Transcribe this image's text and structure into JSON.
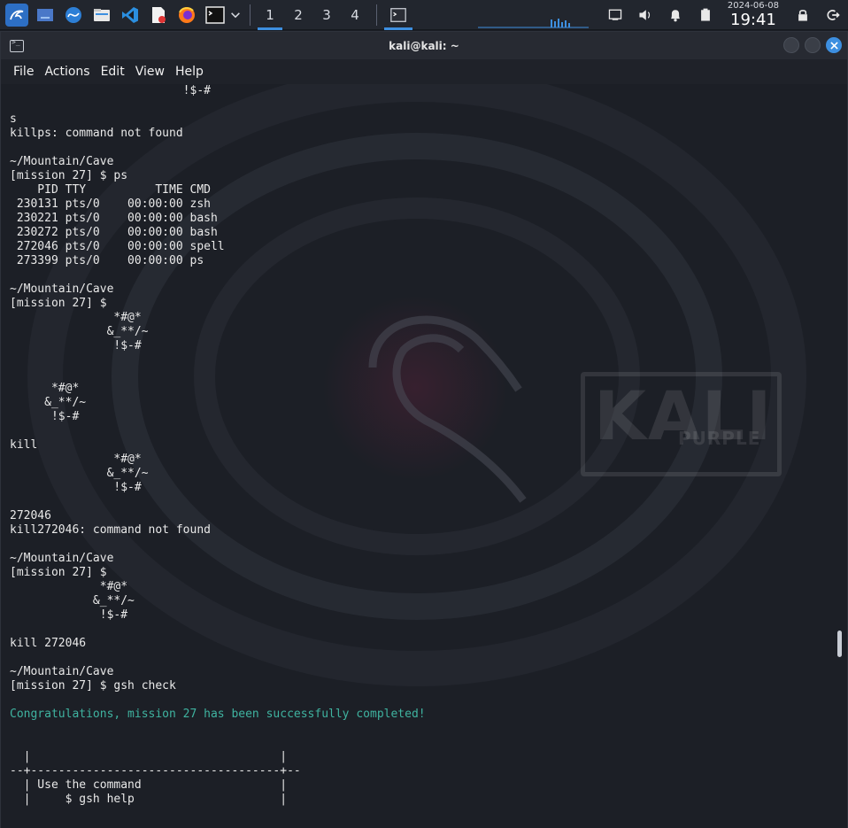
{
  "taskbar": {
    "workspaces": [
      "1",
      "2",
      "3",
      "4"
    ],
    "active_workspace": 0,
    "clock": {
      "date": "2024-06-08",
      "time": "19:41"
    },
    "accent": "#3d8fe0"
  },
  "window": {
    "title": "kali@kali: ~",
    "menu": [
      "File",
      "Actions",
      "Edit",
      "View",
      "Help"
    ]
  },
  "wallpaper": {
    "brand": "KALI",
    "sub": "PURPLE"
  },
  "terminal": {
    "lines": [
      {
        "text": "                         !$-#"
      },
      {
        "text": ""
      },
      {
        "text": "s"
      },
      {
        "text": "killps: command not found"
      },
      {
        "text": ""
      },
      {
        "text": "~/Mountain/Cave"
      },
      {
        "text": "[mission 27] $ ps"
      },
      {
        "text": "    PID TTY          TIME CMD"
      },
      {
        "text": " 230131 pts/0    00:00:00 zsh"
      },
      {
        "text": " 230221 pts/0    00:00:00 bash"
      },
      {
        "text": " 230272 pts/0    00:00:00 bash"
      },
      {
        "text": " 272046 pts/0    00:00:00 spell"
      },
      {
        "text": " 273399 pts/0    00:00:00 ps"
      },
      {
        "text": ""
      },
      {
        "text": "~/Mountain/Cave"
      },
      {
        "text": "[mission 27] $"
      },
      {
        "text": "               *#@*"
      },
      {
        "text": "              &_**/~"
      },
      {
        "text": "               !$-#"
      },
      {
        "text": ""
      },
      {
        "text": ""
      },
      {
        "text": "      *#@*"
      },
      {
        "text": "     &_**/~"
      },
      {
        "text": "      !$-#"
      },
      {
        "text": ""
      },
      {
        "text": "kill"
      },
      {
        "text": "               *#@*"
      },
      {
        "text": "              &_**/~"
      },
      {
        "text": "               !$-#"
      },
      {
        "text": ""
      },
      {
        "text": "272046"
      },
      {
        "text": "kill272046: command not found"
      },
      {
        "text": ""
      },
      {
        "text": "~/Mountain/Cave"
      },
      {
        "text": "[mission 27] $"
      },
      {
        "text": "             *#@*"
      },
      {
        "text": "            &_**/~"
      },
      {
        "text": "             !$-#"
      },
      {
        "text": ""
      },
      {
        "text": "kill 272046"
      },
      {
        "text": ""
      },
      {
        "text": "~/Mountain/Cave"
      },
      {
        "text": "[mission 27] $ gsh check"
      },
      {
        "text": ""
      },
      {
        "text": "Congratulations, mission 27 has been successfully completed!",
        "color": "#3fb3a0"
      },
      {
        "text": ""
      },
      {
        "text": ""
      },
      {
        "text": "  |                                    |"
      },
      {
        "text": "--+------------------------------------+--"
      },
      {
        "text": "  | Use the command                    |"
      },
      {
        "text": "  |     $ gsh help                     |"
      }
    ]
  }
}
